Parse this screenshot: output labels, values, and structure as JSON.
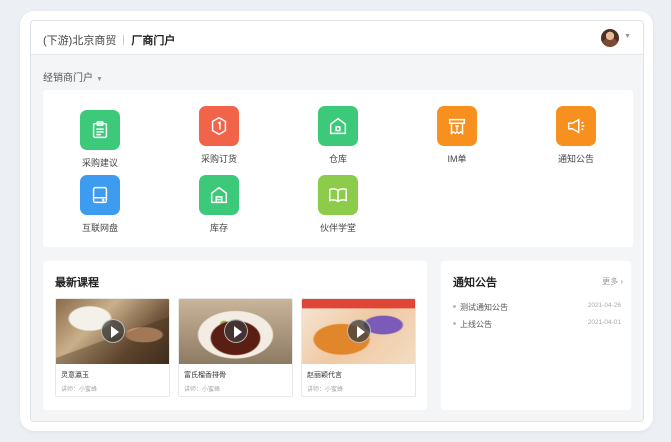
{
  "header": {
    "company": "(下游)北京商贸",
    "portal": "厂商门户"
  },
  "breadcrumb": {
    "label": "经销商门户"
  },
  "apps": [
    {
      "label": "采购建议",
      "icon": "clipboard-icon",
      "color": "#3cc97a"
    },
    {
      "label": "采购订货",
      "icon": "order-icon",
      "color": "#f2644a"
    },
    {
      "label": "仓库",
      "icon": "warehouse-icon",
      "color": "#3cc97a"
    },
    {
      "label": "IM单",
      "icon": "receipt-icon",
      "color": "#f7901e"
    },
    {
      "label": "通知公告",
      "icon": "megaphone-icon",
      "color": "#f7901e"
    },
    {
      "label": "互联网盘",
      "icon": "disk-icon",
      "color": "#3d9bf0"
    },
    {
      "label": "库存",
      "icon": "inventory-icon",
      "color": "#3cc97a"
    },
    {
      "label": "伙伴学堂",
      "icon": "book-icon",
      "color": "#8ccc4a"
    }
  ],
  "courses": {
    "title": "最新课程",
    "items": [
      {
        "name": "灵意瀛玉",
        "lecturer": "讲师：小蜜蜂"
      },
      {
        "name": "富氏榴香排骨",
        "lecturer": "讲师：小蜜蜂"
      },
      {
        "name": "赵丽颖代言",
        "lecturer": "讲师：小蜜蜂"
      }
    ]
  },
  "notices": {
    "title": "通知公告",
    "more": "更多",
    "items": [
      {
        "title": "测试通知公告",
        "date": "2021-04-26"
      },
      {
        "title": "上线公告",
        "date": "2021-04-01"
      }
    ]
  }
}
